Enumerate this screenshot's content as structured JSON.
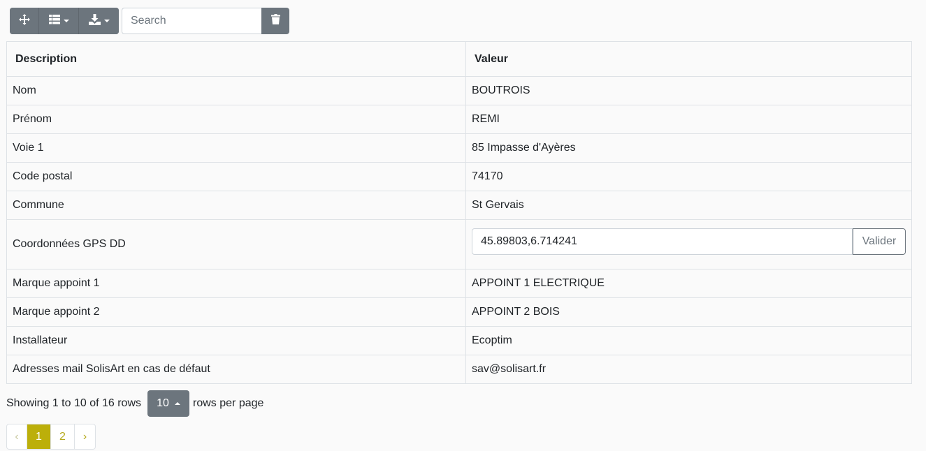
{
  "toolbar": {
    "icons": [
      "move-icon",
      "columns-list-icon",
      "export-download-icon",
      "trash-icon"
    ],
    "search_placeholder": "Search"
  },
  "table": {
    "headers": [
      "Description",
      "Valeur"
    ],
    "rows": [
      {
        "description": "Nom",
        "value": "BOUTROIS"
      },
      {
        "description": "Prénom",
        "value": "REMI"
      },
      {
        "description": "Voie 1",
        "value": "85 Impasse d'Ayères"
      },
      {
        "description": "Code postal",
        "value": "74170"
      },
      {
        "description": "Commune",
        "value": "St Gervais"
      },
      {
        "description": "Coordonnées GPS DD",
        "value": "45.89803,6.714241",
        "button": "Valider"
      },
      {
        "description": "Marque appoint 1",
        "value": "APPOINT 1 ELECTRIQUE"
      },
      {
        "description": "Marque appoint 2",
        "value": "APPOINT 2 BOIS"
      },
      {
        "description": "Installateur",
        "value": "Ecoptim"
      },
      {
        "description": "Adresses mail SolisArt en cas de défaut",
        "value": "sav@solisart.fr"
      }
    ]
  },
  "footer": {
    "showing": "Showing 1 to 10 of 16 rows",
    "page_size": "10",
    "rows_per_page": "rows per page"
  },
  "pagination": {
    "prev": "‹",
    "pages": [
      "1",
      "2"
    ],
    "active": "1",
    "next": "›"
  },
  "colors": {
    "button_gray": "#6c757d",
    "active_page": "#bcaf0a",
    "page_link": "#b5a91b"
  }
}
